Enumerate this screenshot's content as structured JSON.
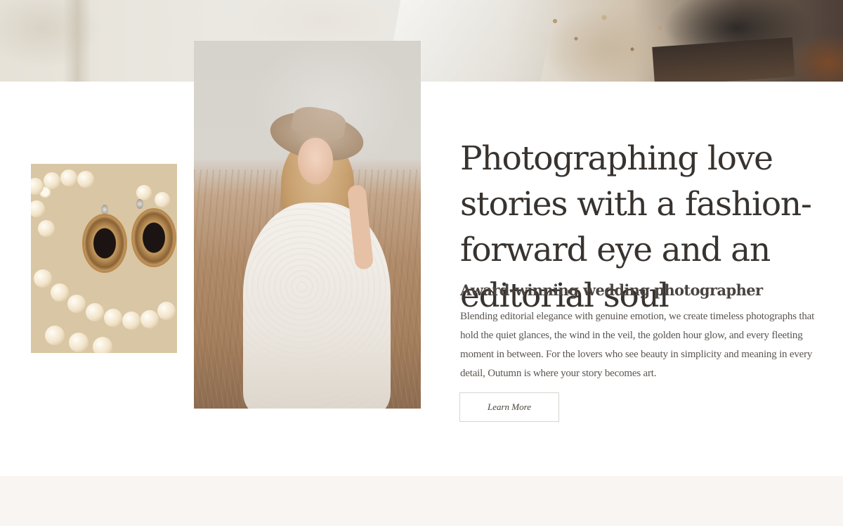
{
  "hero": {
    "headline": "Photographing love stories with a fashion-forward eye and an editorial soul",
    "subheading": "Award-winning wedding photographer",
    "body": "Blending editorial elegance with genuine emotion, we create timeless photographs that hold the quiet glances, the wind in the veil, the golden hour glow, and every fleeting moment in between. For the lovers who see beauty in simplicity and meaning in every detail, Outumn is where your story becomes art.",
    "cta_label": "Learn More"
  },
  "images": {
    "banner": "flatlay-florals-photo",
    "small": "pearl-cameo-earrings-photo",
    "portrait": "woman-in-hat-field-portrait-photo"
  },
  "colors": {
    "text": "#38332f",
    "button_border": "#d8d4cf",
    "bottom_band": "#f9f5f2"
  }
}
